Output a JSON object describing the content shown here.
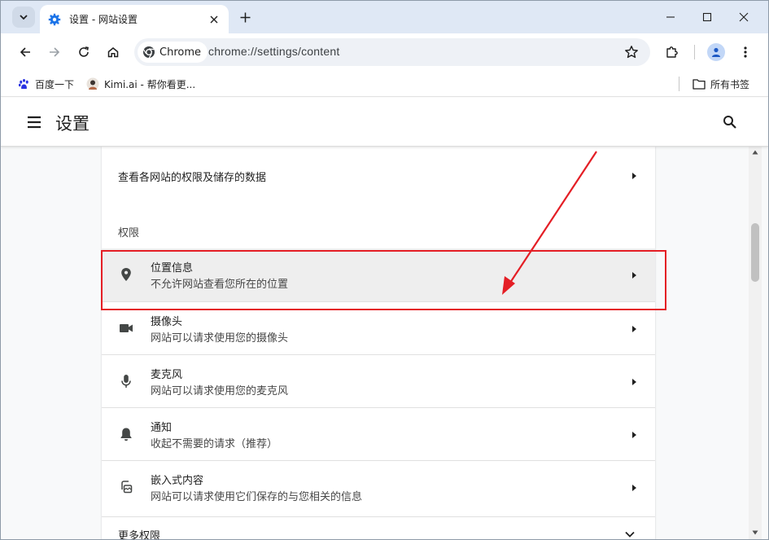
{
  "browser": {
    "tab": {
      "title": "设置 - 网站设置",
      "favicon": "settings-gear-icon"
    },
    "window_controls": [
      "minimize-icon",
      "maximize-icon",
      "close-icon"
    ],
    "toolbar": {
      "chip_label": "Chrome",
      "url": "chrome://settings/content"
    },
    "bookmarks": [
      {
        "label": "百度一下",
        "icon": "baidu-paw-icon"
      },
      {
        "label": "Kimi.ai - 帮你看更...",
        "icon": "kimi-avatar-icon"
      }
    ],
    "all_bookmarks_label": "所有书签"
  },
  "settings": {
    "title": "设置",
    "site_data_row": "查看各网站的权限及储存的数据",
    "permissions_heading": "权限",
    "permissions": [
      {
        "title": "位置信息",
        "subtitle": "不允许网站查看您所在的位置",
        "icon": "location-pin-icon",
        "highlighted": true
      },
      {
        "title": "摄像头",
        "subtitle": "网站可以请求使用您的摄像头",
        "icon": "camera-icon"
      },
      {
        "title": "麦克风",
        "subtitle": "网站可以请求使用您的麦克风",
        "icon": "microphone-icon"
      },
      {
        "title": "通知",
        "subtitle": "收起不需要的请求（推荐）",
        "icon": "bell-icon"
      },
      {
        "title": "嵌入式内容",
        "subtitle": "网站可以请求使用它们保存的与您相关的信息",
        "icon": "embedded-content-icon"
      }
    ],
    "more_permissions": "更多权限"
  },
  "colors": {
    "annotation": "#e41e25",
    "highlight_row": "#eeeeee",
    "tabstrip": "#dfe8f5"
  }
}
